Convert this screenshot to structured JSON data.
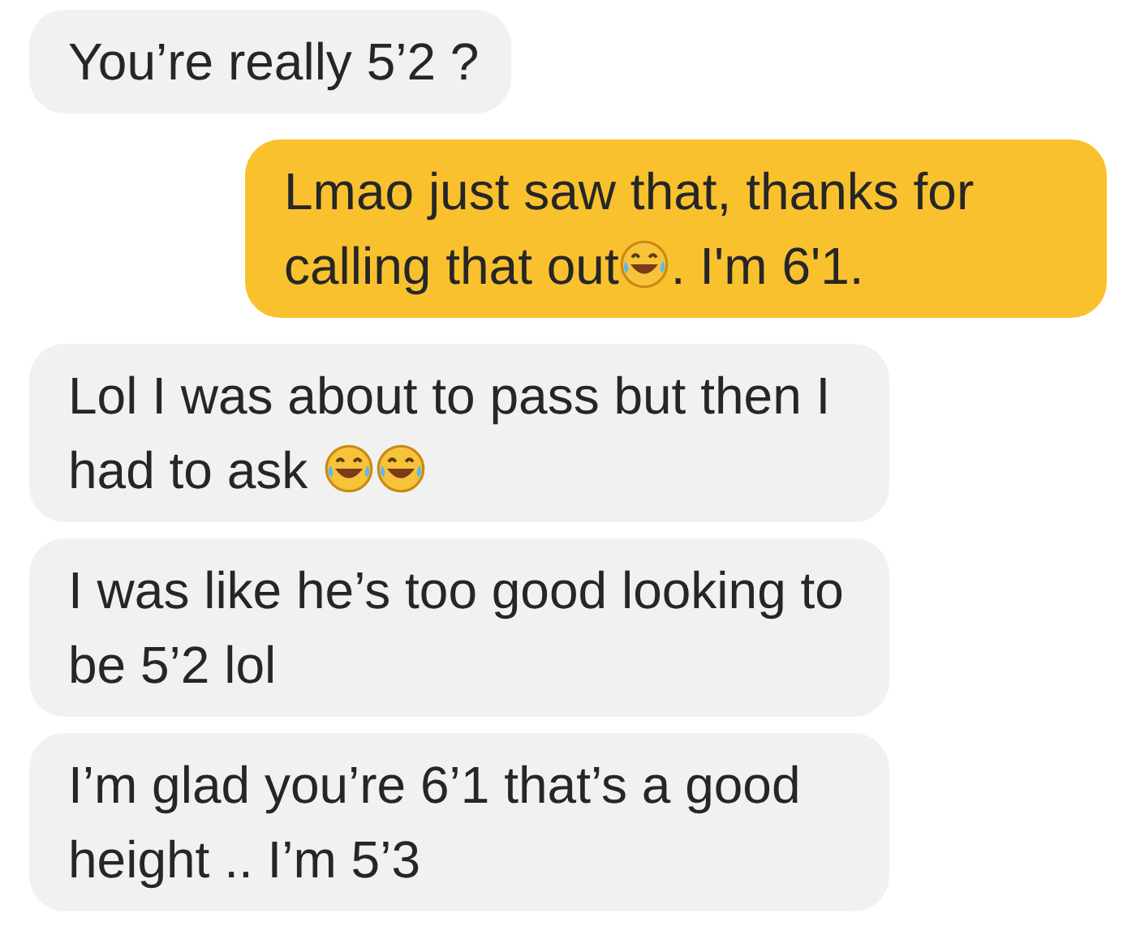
{
  "messages": [
    {
      "outgoing": false,
      "parts": [
        {
          "kind": "text",
          "text": "You’re really 5’2 ?"
        }
      ]
    },
    {
      "outgoing": true,
      "parts": [
        {
          "kind": "text",
          "text": "Lmao just saw that, thanks for calling that out"
        },
        {
          "kind": "emoji"
        },
        {
          "kind": "text",
          "text": ". I'm 6'1."
        }
      ]
    },
    {
      "outgoing": false,
      "parts": [
        {
          "kind": "text",
          "text": "Lol I was about to pass but then I had to ask "
        },
        {
          "kind": "emoji"
        },
        {
          "kind": "emoji"
        }
      ]
    },
    {
      "outgoing": false,
      "parts": [
        {
          "kind": "text",
          "text": "I was like he’s too good looking to be 5’2 lol"
        }
      ]
    },
    {
      "outgoing": false,
      "parts": [
        {
          "kind": "text",
          "text": "I’m glad you’re 6’1 that’s a good height .. I’m 5’3"
        }
      ]
    }
  ]
}
